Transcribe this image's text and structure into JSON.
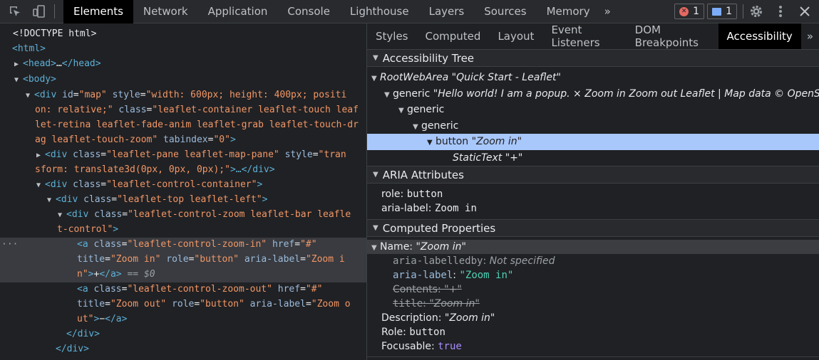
{
  "main_tabs": [
    {
      "label": "Elements",
      "active": true
    },
    {
      "label": "Network"
    },
    {
      "label": "Application"
    },
    {
      "label": "Console"
    },
    {
      "label": "Lighthouse"
    },
    {
      "label": "Layers"
    },
    {
      "label": "Sources"
    },
    {
      "label": "Memory"
    }
  ],
  "toolbar": {
    "more_tabs": "»",
    "error_count": "1",
    "message_count": "1"
  },
  "dom": {
    "doctype": "<!DOCTYPE html>",
    "html_open": "<html>",
    "head": [
      "<head>",
      "…",
      "</head>"
    ],
    "body_open": "<body>",
    "div_map": {
      "open": "<div ",
      "id_attr": "id",
      "id_val": "\"map\"",
      "style_attr": "style",
      "style_val_1": "\"width: 600px; height: 400px; positi",
      "style_val_2": "on: relative;\"",
      "class_attr": "class",
      "class_val_1": "\"leaflet-container leaflet-touch leaf",
      "class_val_2": "let-retina leaflet-fade-anim leaflet-grab leaflet-touch-dr",
      "class_val_3": "ag leaflet-touch-zoom\"",
      "tabindex_attr": "tabindex",
      "tabindex_val": "\"0\"",
      "close": ">"
    },
    "pane": {
      "open": "<div ",
      "class_attr": "class",
      "class_val": "\"leaflet-pane leaflet-map-pane\"",
      "style_attr": "style",
      "style_val_1": "\"tran",
      "style_val_2": "sform: translate3d(0px, 0px, 0px);\"",
      "rest": ">…</div>"
    },
    "control_container": {
      "open": "<div ",
      "class_attr": "class",
      "class_val": "\"leaflet-control-container\"",
      "close": ">"
    },
    "top_left": {
      "open": "<div ",
      "class_attr": "class",
      "class_val": "\"leaflet-top leaflet-left\"",
      "close": ">"
    },
    "zoom_div": {
      "open": "<div ",
      "class_attr": "class",
      "class_val_1": "\"leaflet-control-zoom leaflet-bar leafle",
      "class_val_2": "t-control\"",
      "close": ">"
    },
    "zoom_in": {
      "dots": "···",
      "open": "<a ",
      "class_attr": "class",
      "class_val": "\"leaflet-control-zoom-in\"",
      "href_attr": "href",
      "href_val": "\"#\"",
      "title_attr": "title",
      "title_val": "\"Zoom in\"",
      "role_attr": "role",
      "role_val": "\"button\"",
      "aria_attr": "aria-label",
      "aria_val_1": "\"Zoom i",
      "aria_val_2": "n\"",
      "gt": ">",
      "text": "+",
      "close": "</a>",
      "eq": " == ",
      "dollar": "$0"
    },
    "zoom_out": {
      "open": "<a ",
      "class_attr": "class",
      "class_val": "\"leaflet-control-zoom-out\"",
      "href_attr": "href",
      "href_val": "\"#\"",
      "title_attr": "title",
      "title_val": "\"Zoom out\"",
      "role_attr": "role",
      "role_val": "\"button\"",
      "aria_attr": "aria-label",
      "aria_val_1": "\"Zoom o",
      "aria_val_2": "ut\"",
      "gt": ">",
      "text": "−",
      "close": "</a>"
    },
    "close_div_1": "</div>",
    "close_div_2": "</div>"
  },
  "sub_tabs": [
    {
      "label": "Styles"
    },
    {
      "label": "Computed"
    },
    {
      "label": "Layout"
    },
    {
      "label": "Event Listeners"
    },
    {
      "label": "DOM Breakpoints"
    },
    {
      "label": "Accessibility",
      "active": true
    }
  ],
  "a11y_tree": {
    "header": "Accessibility Tree",
    "root_role": "RootWebArea",
    "root_name": "\"Quick Start - Leaflet\"",
    "generic1_role": "generic",
    "generic1_name": "\"Hello world! I am a popup. × Zoom in Zoom out Leaflet | Map data © OpenStree",
    "generic2_role": "generic",
    "generic3_role": "generic",
    "button_role": "button",
    "button_name": "\"Zoom in\"",
    "static_role": "StaticText",
    "static_name": "\"+\""
  },
  "aria": {
    "header": "ARIA Attributes",
    "role_key": "role",
    "role_val": "button",
    "label_key": "aria-label",
    "label_val": "Zoom in"
  },
  "computed": {
    "header": "Computed Properties",
    "name_key": "Name: ",
    "name_val": "\"Zoom in\"",
    "labelledby_key": "aria-labelledby",
    "labelledby_val": "Not specified",
    "arialabel_key": "aria-label",
    "arialabel_val": "\"Zoom in\"",
    "contents_key": "Contents",
    "contents_val": "\"+\"",
    "title_key": "title",
    "title_val": "\"Zoom in\"",
    "desc_key": "Description: ",
    "desc_val": "\"Zoom in\"",
    "role_key": "Role: ",
    "role_val": "button",
    "focusable_key": "Focusable: ",
    "focusable_val": "true"
  }
}
